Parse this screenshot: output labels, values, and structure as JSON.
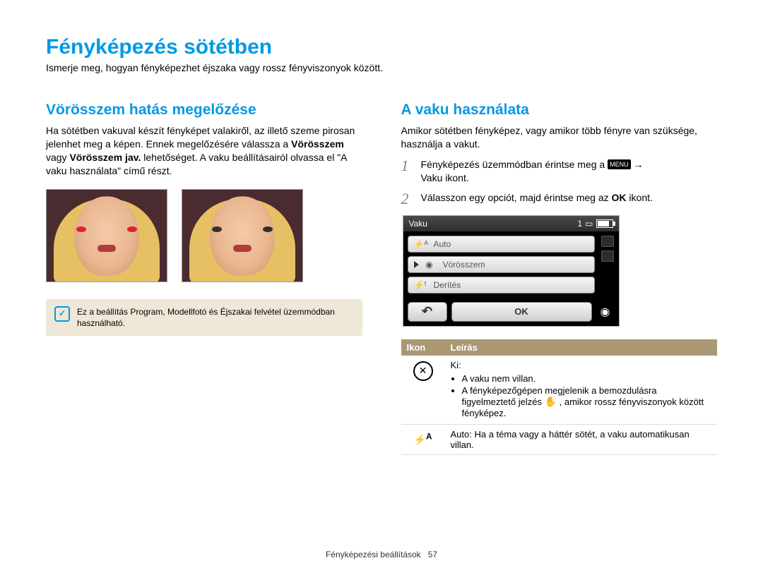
{
  "page": {
    "title": "Fényképezés sötétben",
    "subtitle": "Ismerje meg, hogyan fényképezhet éjszaka vagy rossz fényviszonyok között.",
    "footer_chapter": "Fényképezési beállítások",
    "footer_page": "57"
  },
  "left": {
    "heading": "Vörösszem hatás megelőzése",
    "para_1a": "Ha sötétben vakuval készít fényképet valakiről, az illető szeme pirosan jelenhet meg a képen. Ennek megelőzésére válassza a ",
    "para_1b_bold": "Vörösszem",
    "para_1c": " vagy ",
    "para_1d_bold": "Vörösszem jav.",
    "para_1e": " lehetőséget. A vaku beállításairól olvassa el \"A vaku használata\" című részt.",
    "note": "Ez a beállítás Program, Modellfotó és Éjszakai felvétel üzemmódban használható."
  },
  "right": {
    "heading": "A vaku használata",
    "intro": "Amikor sötétben fényképez, vagy amikor több fényre van szüksége, használja a vakut.",
    "step1_a": "Fényképezés üzemmódban érintse meg a ",
    "step1_menu": "MENU",
    "step1_arrow": "→",
    "step1_b_bold": "Vaku",
    "step1_c": " ikont.",
    "step2_a": "Válasszon egy opciót, majd érintse meg az ",
    "step2_ok": "OK",
    "step2_b": " ikont.",
    "lcd": {
      "title": "Vaku",
      "count": "1",
      "items": [
        {
          "icon": "⚡ᴬ",
          "label": "Auto"
        },
        {
          "icon": "◉",
          "label": "Vörösszem"
        },
        {
          "icon": "⚡ᶠ",
          "label": "Derítés"
        }
      ],
      "back": "↶",
      "ok": "OK"
    },
    "table": {
      "head_icon": "Ikon",
      "head_desc": "Leírás",
      "row1": {
        "icon": "🚫",
        "title": "Ki",
        "title_colon": ":",
        "bullet1": "A vaku nem villan.",
        "bullet2_a": "A fényképezőgépen megjelenik a bemozdulásra figyelmeztető jelzés ",
        "bullet2_icon": "✋",
        "bullet2_b": ", amikor rossz fényviszonyok között fényképez."
      },
      "row2": {
        "icon": "⚡ᴬ",
        "title": "Auto",
        "text": ": Ha a téma vagy a háttér sötét, a vaku automatikusan villan."
      }
    }
  }
}
